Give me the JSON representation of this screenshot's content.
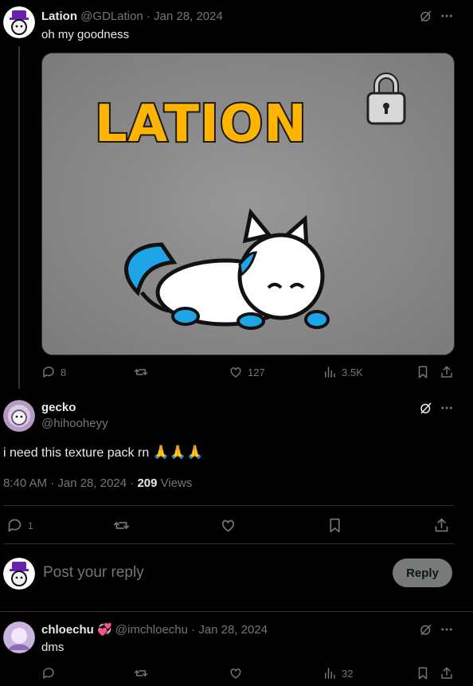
{
  "tweet1": {
    "name": "Lation",
    "handle_meta": "@GDLation · Jan 28, 2024",
    "text": "oh my goodness",
    "image_title": "LATION",
    "actions": {
      "replies": "8",
      "likes": "127",
      "views": "3.5K"
    }
  },
  "focus": {
    "name": "gecko",
    "handle": "@hihooheyy",
    "text": "i need this texture pack rn",
    "emoji": "🙏🙏🙏",
    "time": "8:40 AM · Jan 28, 2024 · ",
    "views_count": "209",
    "views_label": " Views",
    "actions": {
      "replies": "1"
    }
  },
  "compose": {
    "placeholder": "Post your reply",
    "button": "Reply"
  },
  "tweet3": {
    "name": "chloechu",
    "badge_emoji": "💞",
    "handle_meta": "@imchloechu · Jan 28, 2024",
    "text": "dms",
    "actions": {
      "views": "32"
    }
  },
  "colors": {
    "background": "#000000",
    "muted": "#71767b",
    "divider": "#2f3336",
    "image_bg": "#8a8a8a"
  },
  "icons": [
    "grok-icon",
    "more-icon",
    "reply-icon",
    "retweet-icon",
    "like-icon",
    "views-icon",
    "bookmark-icon",
    "share-icon",
    "lock-icon"
  ]
}
